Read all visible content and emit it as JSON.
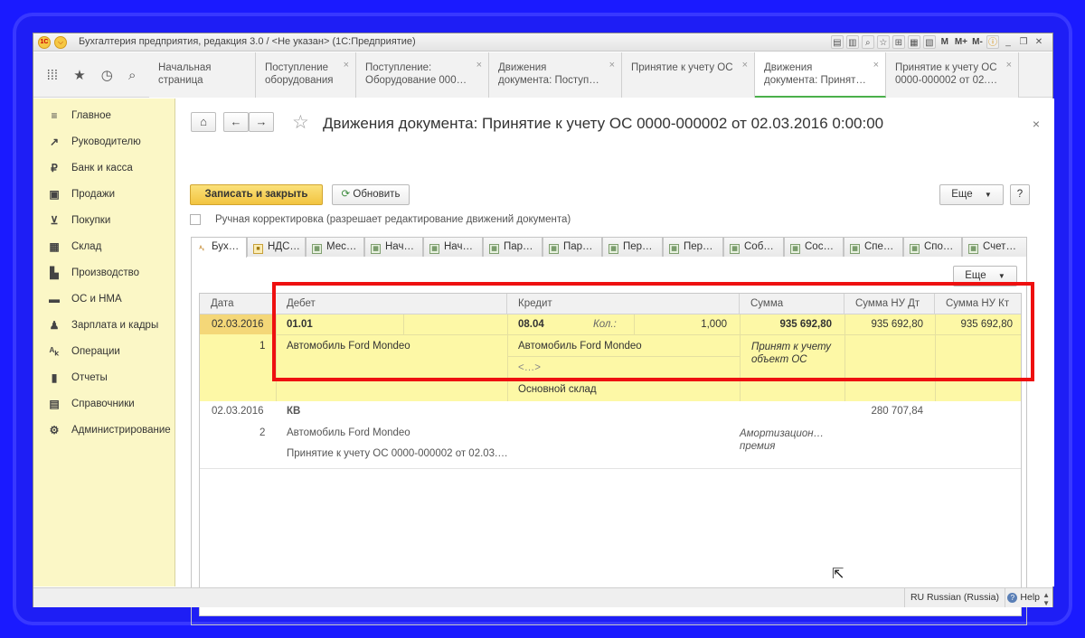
{
  "window": {
    "title": "Бухгалтерия предприятия, редакция 3.0 / <Не указан>  (1С:Предприятие)",
    "logo_text": "1С",
    "menu_glyph": "⌵",
    "tool_labels": [
      "M",
      "M+",
      "M-"
    ],
    "controls": [
      "_",
      "❐",
      "✕"
    ]
  },
  "tabs": [
    {
      "label": "Начальная страница",
      "closable": false,
      "active": false
    },
    {
      "label": "Поступление\nоборудования",
      "closable": true,
      "active": false
    },
    {
      "label": "Поступление:\nОборудование 000…",
      "closable": true,
      "active": false
    },
    {
      "label": "Движения\nдокумента: Поступ…",
      "closable": true,
      "active": false
    },
    {
      "label": "Принятие к учету ОС",
      "closable": true,
      "active": false
    },
    {
      "label": "Движения\nдокумента: Принят…",
      "closable": true,
      "active": true
    },
    {
      "label": "Принятие к учету ОС\n0000-000002 от 02.…",
      "closable": true,
      "active": false
    }
  ],
  "sidebar": {
    "items": [
      {
        "label": "Главное",
        "icon": "≡"
      },
      {
        "label": "Руководителю",
        "icon": "↗"
      },
      {
        "label": "Банк и касса",
        "icon": "₽"
      },
      {
        "label": "Продажи",
        "icon": "▣"
      },
      {
        "label": "Покупки",
        "icon": "⊻"
      },
      {
        "label": "Склад",
        "icon": "▦"
      },
      {
        "label": "Производство",
        "icon": "▙"
      },
      {
        "label": "ОС и НМА",
        "icon": "▬"
      },
      {
        "label": "Зарплата и кадры",
        "icon": "♟"
      },
      {
        "label": "Операции",
        "icon": "ᴬₖ"
      },
      {
        "label": "Отчеты",
        "icon": "▮"
      },
      {
        "label": "Справочники",
        "icon": "▤"
      },
      {
        "label": "Администрирование",
        "icon": "⚙"
      }
    ]
  },
  "page": {
    "title": "Движения документа: Принятие к учету ОС 0000-000002 от 02.03.2016 0:00:00",
    "save_close": "Записать и закрыть",
    "refresh": "Обновить",
    "more": "Еще",
    "help": "?",
    "manual_edit": "Ручная корректировка (разрешает редактирование движений документа)"
  },
  "register_tabs": [
    "Бух…",
    "НДС…",
    "Мес…",
    "Нач…",
    "Нач…",
    "Пар…",
    "Пар…",
    "Пер…",
    "Пер…",
    "Соб…",
    "Сос…",
    "Спе…",
    "Спо…",
    "Счет…"
  ],
  "table": {
    "more": "Еще",
    "headers": [
      "Дата",
      "Дебет",
      "Кредит",
      "Сумма",
      "Сумма НУ Дт",
      "Сумма НУ Кт"
    ],
    "rows": [
      {
        "date": "02.03.2016",
        "num": "1",
        "debit_account": "01.01",
        "debit_sub1": "Автомобиль Ford Mondeo",
        "credit_account": "08.04",
        "qty_label": "Кол.:",
        "qty": "1,000",
        "credit_sub1": "Автомобиль Ford Mondeo",
        "credit_sub2": "<…>",
        "credit_sub3": "Основной склад",
        "amount": "935 692,80",
        "content": "Принят к учету\nобъект ОС",
        "nu_dt": "935 692,80",
        "nu_kt": "935 692,80"
      },
      {
        "date": "02.03.2016",
        "num": "2",
        "debit_account": "КВ",
        "debit_sub1": "Автомобиль Ford Mondeo",
        "debit_sub2": "Принятие к учету ОС 0000-000002 от 02.03.…",
        "content": "Амортизацион…\n премия",
        "nu_dt": "280 707,84"
      }
    ]
  },
  "status": {
    "language": "RU Russian (Russia)",
    "help": "Help"
  },
  "colors": {
    "highlight": "#fdf8a6",
    "date_highlight": "#f4d778",
    "red_box": "#ee1010",
    "active_tab_underline": "#4ab04a"
  }
}
